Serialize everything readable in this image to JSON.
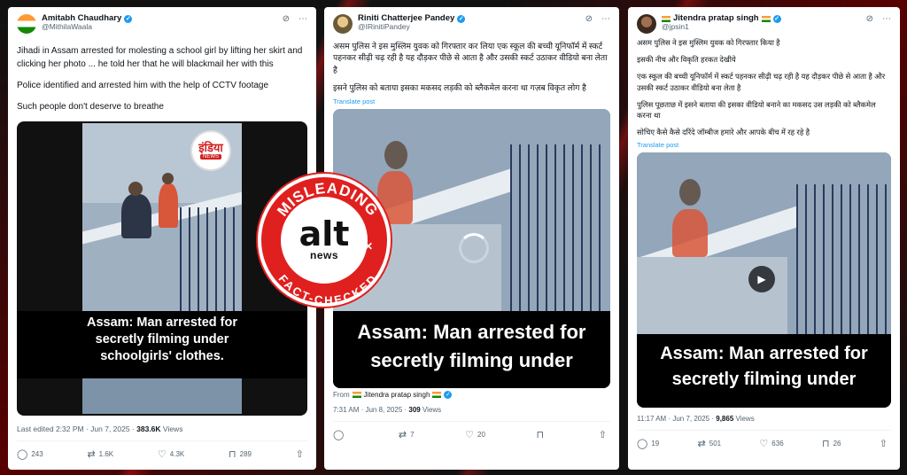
{
  "tweets": [
    {
      "author": "Amitabh Chaudhary",
      "handle": "@MithilaWaala",
      "paragraphs": [
        "Jihadi in Assam arrested for molesting a school girl by lifting her skirt and clicking her photo ... he told her that he will blackmail her with this",
        "Police identified and arrested him with the help of CCTV footage",
        "Such people don't deserve to breathe"
      ],
      "video_caption": "Assam: Man arrested for secretly filming under schoolgirls' clothes.",
      "logo_text": "इंडिया",
      "logo_sub": "NEWS",
      "meta_prefix": "Last edited 2:32 PM · Jun 7, 2025 · ",
      "views": "383.6K",
      "views_label": " Views",
      "replies": "243",
      "reposts": "1.6K",
      "likes": "4.3K",
      "bookmarks": "289"
    },
    {
      "author": "Riniti Chatterjee Pandey",
      "handle": "@IRinitiPandey",
      "paragraphs": [
        "असम पुलिस ने इस मुस्लिम युवक को गिरफ्तार कर लिया एक स्कूल की बच्ची यूनिफॉर्म में स्कर्ट पहनकर सीढ़ी चढ़ रही है यह दौड़कर पीछे से आता है और उसकी स्कर्ट उठाकर वीडियो बना लेता है",
        "इसने पुलिस को बताया इसका मकसद लड़की को ब्लैकमेल करना था गज़ब विकृत लोग है"
      ],
      "translate": "Translate post",
      "video_caption": "Assam: Man arrested for secretly filming under",
      "from_label": "From",
      "from_name": "Jitendra pratap singh",
      "meta_prefix": "7:31 AM · Jun 8, 2025 · ",
      "views": "309",
      "views_label": " Views",
      "replies": "",
      "reposts": "7",
      "likes": "20",
      "bookmarks": ""
    },
    {
      "author": "Jitendra pratap singh",
      "handle": "@jpsin1",
      "paragraphs": [
        "असम पुलिस ने इस मुस्लिम युवक को गिरफ्तार किया है",
        "इसकी नीच और विकृति हरकत देखीये",
        "एक स्कूल की बच्ची यूनिफॉर्म में स्कर्ट पहनकर सीढ़ी चढ़ रही है यह दौड़कर पीछे से आता है और उसकी स्कर्ट उठाकर वीडियो बना लेता है",
        "पुलिस पूछताछ में इसने बताया की इसका वीडियो बनाने का मकसद उस लड़की को ब्लैकमेल करना था",
        "सोचिए कैसे कैसे दरिंदे जॉम्बीज हमारे और आपके बीच में रह रहे है"
      ],
      "translate": "Translate post",
      "video_caption": "Assam: Man arrested for secretly filming under",
      "meta_prefix": "11:17 AM · Jun 7, 2025 · ",
      "views": "9,865",
      "views_label": " Views",
      "replies": "19",
      "reposts": "501",
      "likes": "636",
      "bookmarks": "26"
    }
  ],
  "stamp": {
    "top_text": "MISLEADING",
    "bottom_text": "FACT-CHECKED",
    "logo_main": "alt",
    "logo_sub": "news",
    "color": "#e0201f"
  },
  "colors": {
    "link": "#1d9bf0",
    "muted": "#536471"
  }
}
